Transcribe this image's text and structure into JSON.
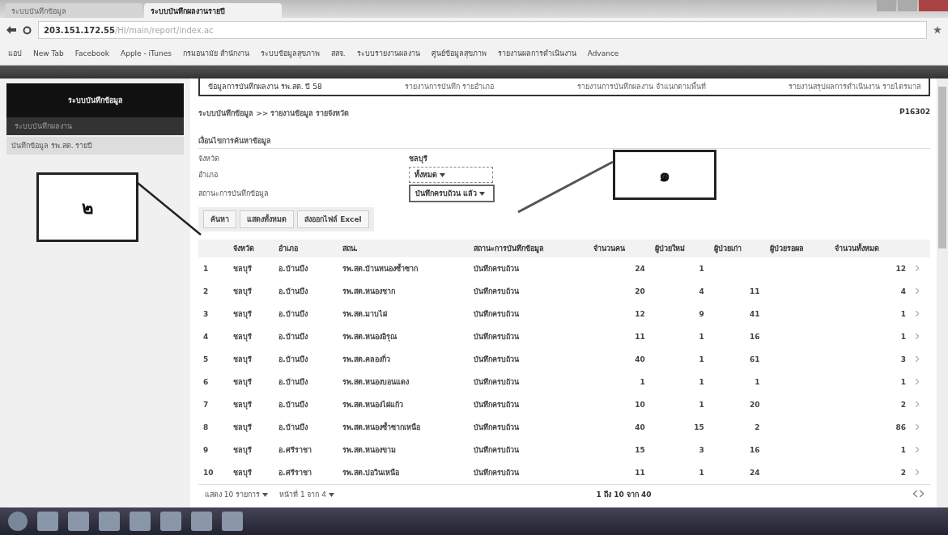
{
  "browser": {
    "tabs": [
      {
        "label": "ระบบบันทึกข้อมูล",
        "selected": false
      },
      {
        "label": "ระบบบันทึกผลงานรายปี",
        "selected": true
      }
    ],
    "address": "203.151.172.55",
    "address_rest": "/HI/main/report/index.ac",
    "bookmarks": [
      "แอป",
      "New Tab",
      "Facebook",
      "Apple - iTunes",
      "กรมอนามัย สำนักงาน",
      "ระบบข้อมูลสุขภาพ",
      "สสจ.",
      "ระบบรายงานผลงาน",
      "ศูนย์ข้อมูลสุขภาพ",
      "รายงานผลการดำเนินงาน",
      "Advance"
    ]
  },
  "sidebar": {
    "title": "ระบบบันทึกข้อมูล",
    "subtitle": "ระบบบันทึกผลงาน",
    "items": [
      "บันทึกข้อมูล รพ.สต. รายปี"
    ]
  },
  "menu": [
    {
      "label": "ข้อมูลการบันทึกผลงาน รพ.สต. ปี 58",
      "selected": true
    },
    {
      "label": "รายงานการบันทึก รายอำเภอ",
      "selected": false
    },
    {
      "label": "รายงานการบันทึกผลงาน จำแนกตามพื้นที่",
      "selected": false
    },
    {
      "label": "รายงานสรุปผลการดำเนินงาน รายไตรมาส",
      "selected": false
    }
  ],
  "breadcrumb": "ระบบบันทึกข้อมูล >> รายงานข้อมูล รายจังหวัด",
  "page_code": "P16302",
  "filter": {
    "title": "เงื่อนไขการค้นหาข้อมูล",
    "fields": [
      {
        "label": "จังหวัด",
        "kind": "text",
        "value": "ชลบุรี"
      },
      {
        "label": "อำเภอ",
        "kind": "select",
        "value": "ทั้งหมด"
      },
      {
        "label": "สถานะการบันทึกข้อมูล",
        "kind": "select",
        "value": "บันทึกครบถ้วน แล้ว"
      }
    ]
  },
  "buttons": [
    "ค้นหา",
    "แสดงทั้งหมด",
    "ส่งออกไฟล์ Excel"
  ],
  "table": {
    "columns": [
      "จังหวัด",
      "อำเภอ",
      "สถน.",
      "สถานะการบันทึกข้อมูล",
      "จำนวนคน",
      "ผู้ป่วยใหม่",
      "ผู้ป่วยเก่า",
      "ผู้ป่วยรอผล",
      "จำนวนทั้งหมด"
    ],
    "rows": [
      {
        "n": "1",
        "province": "ชลบุรี",
        "district": "อ.บ้านบึง",
        "unit": "รพ.สต.บ้านหนองซ้ำซาก",
        "status": "บันทึกครบถ้วน",
        "c1": "24",
        "c2": "1",
        "c3": "",
        "c5": "12"
      },
      {
        "n": "2",
        "province": "ชลบุรี",
        "district": "อ.บ้านบึง",
        "unit": "รพ.สต.หนองชาก",
        "status": "บันทึกครบถ้วน",
        "c1": "20",
        "c2": "4",
        "c3": "11",
        "c5": "4"
      },
      {
        "n": "3",
        "province": "ชลบุรี",
        "district": "อ.บ้านบึง",
        "unit": "รพ.สต.มาบไผ่",
        "status": "บันทึกครบถ้วน",
        "c1": "12",
        "c2": "9",
        "c3": "41",
        "c5": "1"
      },
      {
        "n": "4",
        "province": "ชลบุรี",
        "district": "อ.บ้านบึง",
        "unit": "รพ.สต.หนองอิรุณ",
        "status": "บันทึกครบถ้วน",
        "c1": "11",
        "c2": "1",
        "c3": "16",
        "c5": "1"
      },
      {
        "n": "5",
        "province": "ชลบุรี",
        "district": "อ.บ้านบึง",
        "unit": "รพ.สต.คลองกิ่ว",
        "status": "บันทึกครบถ้วน",
        "c1": "40",
        "c2": "1",
        "c3": "61",
        "c5": "3"
      },
      {
        "n": "6",
        "province": "ชลบุรี",
        "district": "อ.บ้านบึง",
        "unit": "รพ.สต.หนองบอนแดง",
        "status": "บันทึกครบถ้วน",
        "c1": "1",
        "c2": "1",
        "c3": "1",
        "c5": "1"
      },
      {
        "n": "7",
        "province": "ชลบุรี",
        "district": "อ.บ้านบึง",
        "unit": "รพ.สต.หนองไผ่แก้ว",
        "status": "บันทึกครบถ้วน",
        "c1": "10",
        "c2": "1",
        "c3": "20",
        "c5": "2"
      },
      {
        "n": "8",
        "province": "ชลบุรี",
        "district": "อ.บ้านบึง",
        "unit": "รพ.สต.หนองซ้ำซากเหนือ",
        "status": "บันทึกครบถ้วน",
        "c1": "40",
        "c2": "15",
        "c3": "2",
        "c5": "86"
      },
      {
        "n": "9",
        "province": "ชลบุรี",
        "district": "อ.ศรีราชา",
        "unit": "รพ.สต.หนองขาม",
        "status": "บันทึกครบถ้วน",
        "c1": "15",
        "c2": "3",
        "c3": "16",
        "c5": "1"
      },
      {
        "n": "10",
        "province": "ชลบุรี",
        "district": "อ.ศรีราชา",
        "unit": "รพ.สต.บ่อวินเหนือ",
        "status": "บันทึกครบถ้วน",
        "c1": "11",
        "c2": "1",
        "c3": "24",
        "c5": "2"
      }
    ]
  },
  "pager": {
    "page_size": "แสดง 10 รายการ",
    "page": "หน้าที่ 1 จาก 4",
    "summary": "1 ถึง 10 จาก 40"
  },
  "annotations": [
    {
      "label": "๑"
    },
    {
      "label": "๒"
    }
  ]
}
